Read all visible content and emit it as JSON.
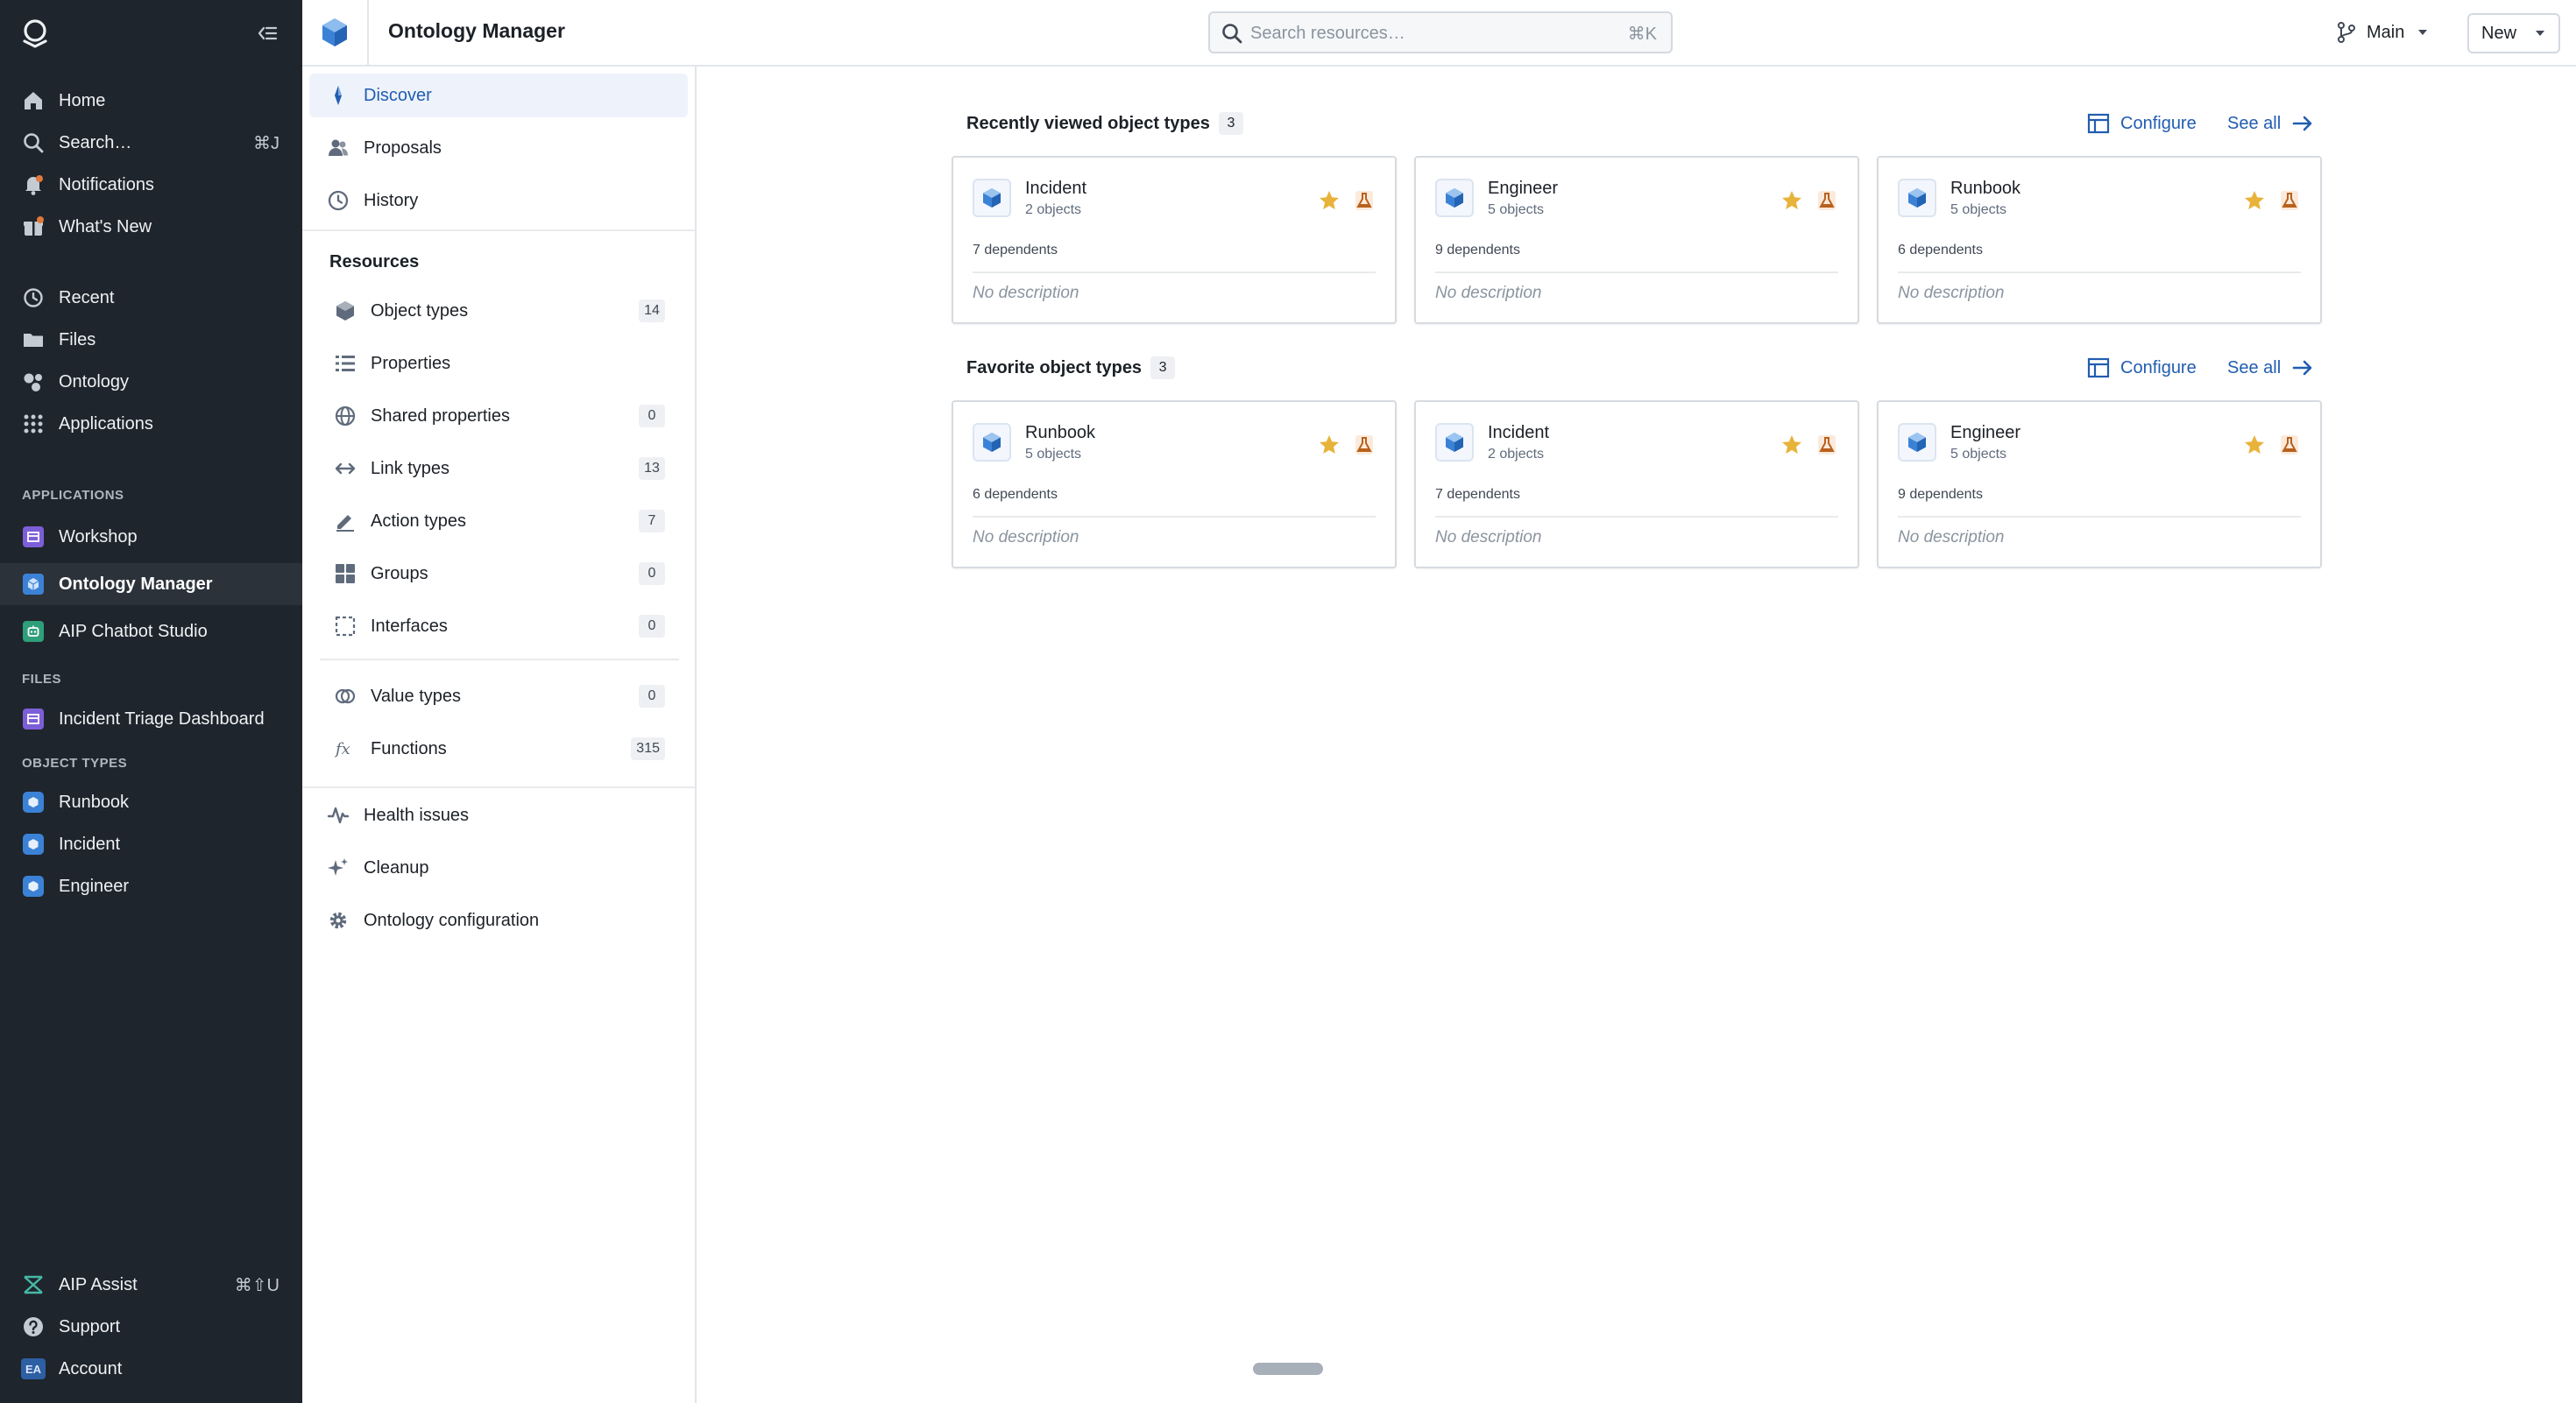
{
  "global_nav": {
    "top": [
      {
        "label": "Home",
        "icon": "home-icon"
      },
      {
        "label": "Search…",
        "icon": "search-icon",
        "shortcut": "⌘J"
      },
      {
        "label": "Notifications",
        "icon": "bell-icon"
      },
      {
        "label": "What's New",
        "icon": "gift-icon"
      }
    ],
    "main": [
      {
        "label": "Recent",
        "icon": "history-icon"
      },
      {
        "label": "Files",
        "icon": "folder-icon"
      },
      {
        "label": "Ontology",
        "icon": "ontology-icon"
      },
      {
        "label": "Applications",
        "icon": "grid-icon"
      }
    ],
    "applications_heading": "APPLICATIONS",
    "applications": [
      {
        "label": "Workshop",
        "color": "#7c5fd8"
      },
      {
        "label": "Ontology Manager",
        "color": "#3b82d6",
        "active": true
      },
      {
        "label": "AIP Chatbot Studio",
        "color": "#2f9e7a"
      }
    ],
    "files_heading": "FILES",
    "files": [
      {
        "label": "Incident Triage Dashboard",
        "color": "#7c5fd8"
      }
    ],
    "object_types_heading": "OBJECT TYPES",
    "object_types": [
      {
        "label": "Runbook"
      },
      {
        "label": "Incident"
      },
      {
        "label": "Engineer"
      }
    ],
    "bottom": [
      {
        "label": "AIP Assist",
        "icon": "aip-icon",
        "shortcut": "⌘⇧U"
      },
      {
        "label": "Support",
        "icon": "help-icon"
      },
      {
        "label": "Account",
        "icon": "avatar",
        "initials": "EA"
      }
    ]
  },
  "topbar": {
    "title": "Ontology Manager",
    "search_placeholder": "Search resources…",
    "search_shortcut": "⌘K",
    "branch": "Main",
    "new_label": "New"
  },
  "sidebar": {
    "nav": [
      {
        "label": "Discover",
        "icon": "compass-icon",
        "active": true
      },
      {
        "label": "Proposals",
        "icon": "people-icon"
      },
      {
        "label": "History",
        "icon": "history-icon"
      }
    ],
    "resources_heading": "Resources",
    "resources": [
      {
        "label": "Object types",
        "icon": "cube-icon",
        "count": "14"
      },
      {
        "label": "Properties",
        "icon": "list-icon",
        "count": ""
      },
      {
        "label": "Shared properties",
        "icon": "globe-icon",
        "count": "0"
      },
      {
        "label": "Link types",
        "icon": "arrows-icon",
        "count": "13"
      },
      {
        "label": "Action types",
        "icon": "edit-icon",
        "count": "7"
      },
      {
        "label": "Groups",
        "icon": "groups-icon",
        "count": "0"
      },
      {
        "label": "Interfaces",
        "icon": "interface-icon",
        "count": "0"
      }
    ],
    "more": [
      {
        "label": "Value types",
        "icon": "value-type-icon",
        "count": "0"
      },
      {
        "label": "Functions",
        "icon": "function-icon",
        "count": "315"
      }
    ],
    "tools": [
      {
        "label": "Health issues",
        "icon": "pulse-icon"
      },
      {
        "label": "Cleanup",
        "icon": "sparkle-icon"
      },
      {
        "label": "Ontology configuration",
        "icon": "gear-icon"
      }
    ]
  },
  "main": {
    "recent": {
      "title": "Recently viewed object types",
      "count": "3",
      "configure": "Configure",
      "see_all": "See all",
      "cards": [
        {
          "name": "Incident",
          "objects": "2 objects",
          "dependents": "7 dependents",
          "description": "No description"
        },
        {
          "name": "Engineer",
          "objects": "5 objects",
          "dependents": "9 dependents",
          "description": "No description"
        },
        {
          "name": "Runbook",
          "objects": "5 objects",
          "dependents": "6 dependents",
          "description": "No description"
        }
      ]
    },
    "favorites": {
      "title": "Favorite object types",
      "count": "3",
      "configure": "Configure",
      "see_all": "See all",
      "cards": [
        {
          "name": "Runbook",
          "objects": "5 objects",
          "dependents": "6 dependents",
          "description": "No description"
        },
        {
          "name": "Incident",
          "objects": "2 objects",
          "dependents": "7 dependents",
          "description": "No description"
        },
        {
          "name": "Engineer",
          "objects": "5 objects",
          "dependents": "9 dependents",
          "description": "No description"
        }
      ]
    }
  },
  "colors": {
    "accent": "#215db0",
    "nav_bg": "#1f252c",
    "star": "#e8b33a",
    "flask": "#b8611d"
  }
}
